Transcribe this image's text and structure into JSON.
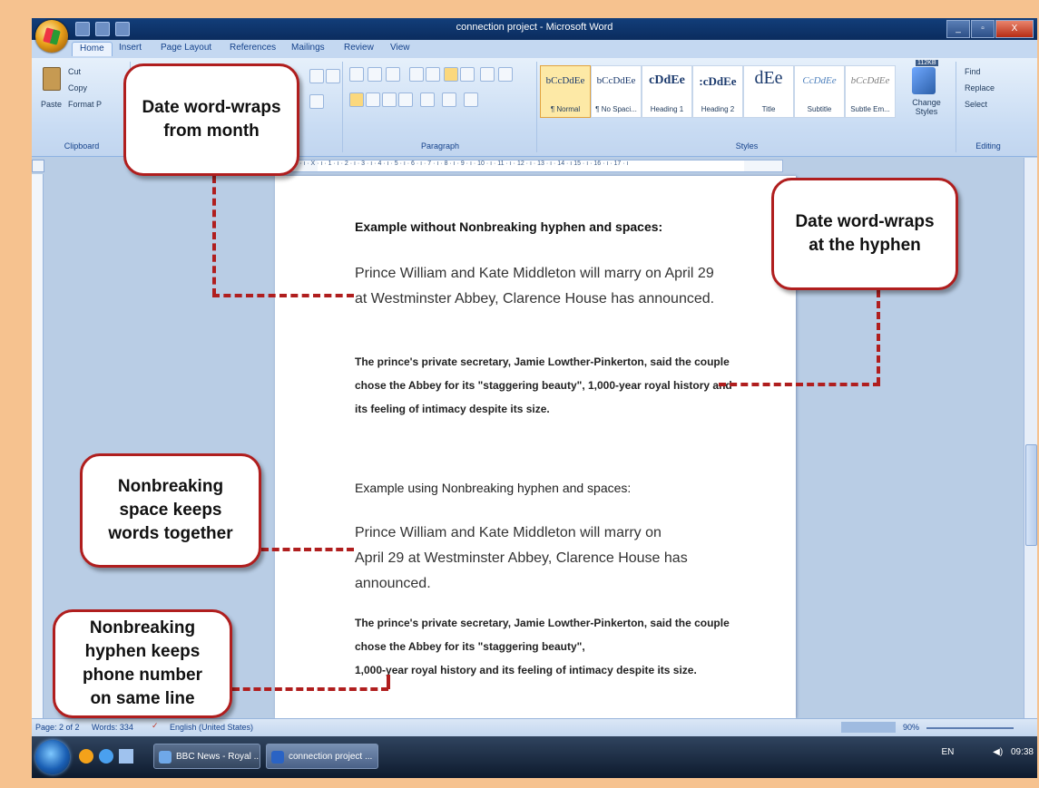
{
  "window": {
    "title": "connection project - Microsoft Word",
    "buttons": [
      "_",
      "▫",
      "X"
    ]
  },
  "tabs": [
    "Home",
    "Insert",
    "Page Layout",
    "References",
    "Mailings",
    "Review",
    "View"
  ],
  "ribbon": {
    "clipboard": {
      "paste": "Paste",
      "cut": "Cut",
      "copy": "Copy",
      "format_painter": "Format P",
      "label": "Clipboard"
    },
    "paragraph_label": "Paragraph",
    "styles": [
      {
        "sample": "bCcDdEe",
        "name": "¶ Normal"
      },
      {
        "sample": "bCcDdEe",
        "name": "¶ No Spaci..."
      },
      {
        "sample": "cDdEe",
        "name": "Heading 1"
      },
      {
        "sample": ":cDdEe",
        "name": "Heading 2"
      },
      {
        "sample": "dEe",
        "name": "Title"
      },
      {
        "sample": "CcDdEe",
        "name": "Subtitle"
      },
      {
        "sample": "bCcDdEe",
        "name": "Subtle Em..."
      }
    ],
    "styles_label": "Styles",
    "change_styles": "Change Styles",
    "size_badge": "112KB",
    "editing": {
      "find": "Find",
      "replace": "Replace",
      "select": "Select",
      "label": "Editing"
    }
  },
  "ruler_text": "2 · ı · 1 · ı · X · ı · 1 · ı · 2 · ı · 3 · ı · 4 · ı · 5 · ı · 6 · ı · 7 · ı · 8 · ı · 9 · ı · 10 · ı · 11 · ı · 12 · ı · 13 · ı · 14 · ı 15 · ı · 16 · ı · 17 · ı",
  "document": {
    "heading1": "Example without Nonbreaking hyphen and spaces:",
    "para1": "Prince William and Kate Middleton will marry on April 29 at Westminster Abbey, Clarence House has announced.",
    "bold1": "The prince's private secretary, Jamie Lowther-Pinkerton, said the couple chose the Abbey for its \"staggering beauty\", 1,000-year royal history and its feeling of intimacy despite its size.",
    "heading2": "Example using Nonbreaking hyphen and spaces:",
    "para2_line1": "Prince William and Kate Middleton will marry on",
    "para2_rest": "April 29 at Westminster Abbey, Clarence House has announced.",
    "bold2_line1": "The prince's private secretary, Jamie Lowther-Pinkerton, said the couple chose the Abbey for its \"staggering beauty\",",
    "bold2_rest": "1,000-year royal history and its feeling of intimacy despite its size."
  },
  "status": {
    "page": "Page: 2 of 2",
    "words": "Words: 334",
    "language": "English (United States)",
    "zoom": "90%"
  },
  "taskbar": {
    "items": [
      "BBC News - Royal ...",
      "connection project ..."
    ],
    "lang": "EN",
    "time": "09:38"
  },
  "callouts": {
    "month": "Date word-wraps\nfrom month",
    "hyphen": "Date word-wraps\nat the hyphen",
    "space": "Nonbreaking\nspace keeps\nwords together",
    "phone": "Nonbreaking\nhyphen keeps\nphone number\non same line"
  },
  "colors": {
    "accent": "#b01e1e",
    "ribbon": "#c9dcf3",
    "background": "#f6c28f"
  }
}
